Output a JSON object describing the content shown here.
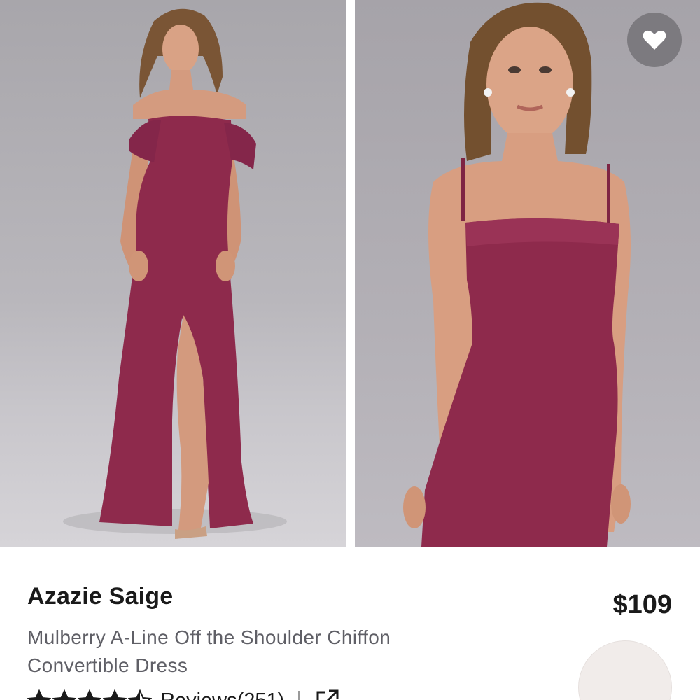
{
  "product": {
    "brand": "Azazie Saige",
    "title": "Mulberry A-Line Off the Shoulder Chiffon Convertible Dress",
    "price": "$109",
    "reviews_label": "Reviews(251)",
    "rating": 4.5,
    "rating_max": 5
  },
  "icons": {
    "favorite": "heart-icon",
    "share": "share-external-icon",
    "star": "star-icon"
  },
  "colors": {
    "dress": "#8e2a4c",
    "swatch": "#f1ecea",
    "price_text": "#1a1a1a",
    "title_text": "#5f5f66"
  }
}
